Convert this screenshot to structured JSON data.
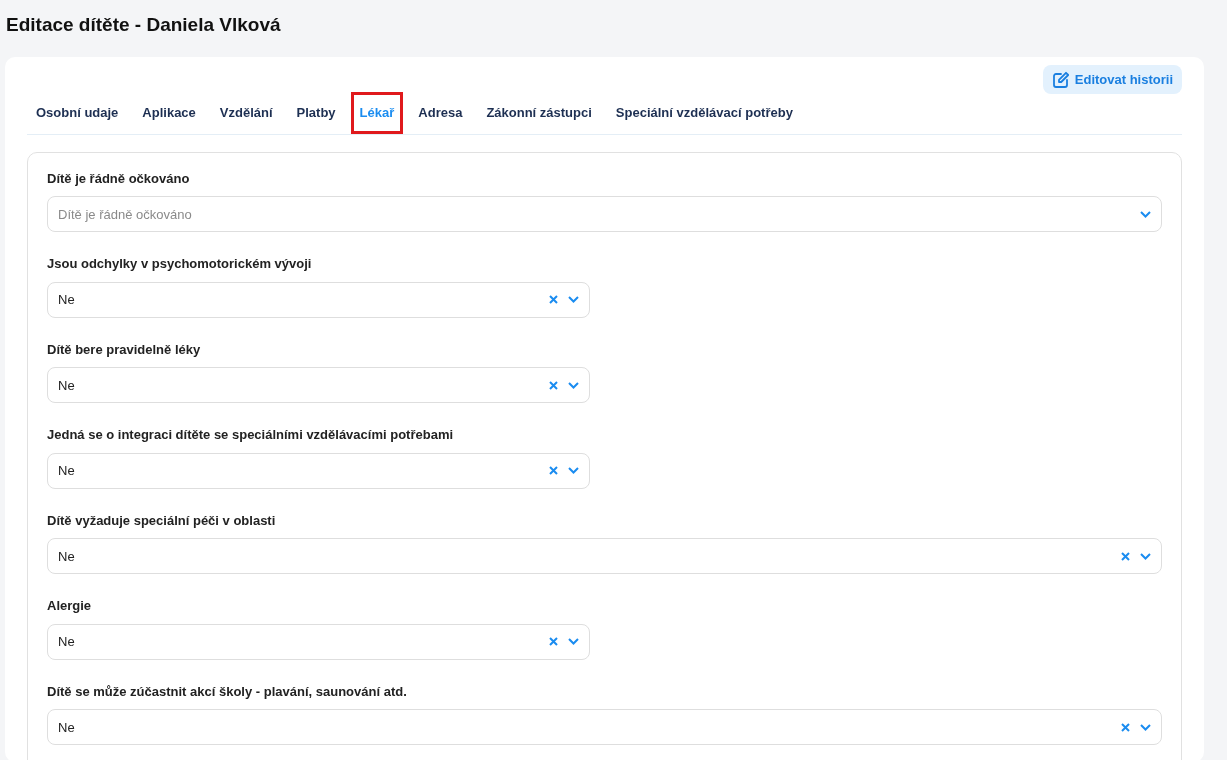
{
  "page_title": "Editace dítěte - Daniela Vlková",
  "history_button": "Editovat historii",
  "tabs": [
    {
      "label": "Osobní udaje",
      "selected": false,
      "highlighted": false
    },
    {
      "label": "Aplikace",
      "selected": false,
      "highlighted": false
    },
    {
      "label": "Vzdělání",
      "selected": false,
      "highlighted": false
    },
    {
      "label": "Platby",
      "selected": false,
      "highlighted": false
    },
    {
      "label": "Lékař",
      "selected": true,
      "highlighted": true
    },
    {
      "label": "Adresa",
      "selected": false,
      "highlighted": false
    },
    {
      "label": "Zákonní zástupci",
      "selected": false,
      "highlighted": false
    },
    {
      "label": "Speciální vzdělávací potřeby",
      "selected": false,
      "highlighted": false
    }
  ],
  "fields": [
    {
      "label": "Dítě je řádně očkováno",
      "placeholder": "Dítě je řádně očkováno",
      "kind": "wide"
    },
    {
      "label": "Jsou odchylky v psychomotorickém vývoji",
      "value": "Ne",
      "kind": "narrow"
    },
    {
      "label": "Dítě bere pravidelně léky",
      "value": "Ne",
      "kind": "narrow"
    },
    {
      "label": "Jedná se o integraci dítěte se speciálními vzdělávacími potřebami",
      "value": "Ne",
      "kind": "narrow"
    },
    {
      "label": "Dítě vyžaduje speciální péči v oblasti",
      "value": "Ne",
      "kind": "wide"
    },
    {
      "label": "Alergie",
      "value": "Ne",
      "kind": "narrow"
    },
    {
      "label": "Dítě se může zúčastnit akcí školy - plavání, saunování atd.",
      "value": "Ne",
      "kind": "wide"
    }
  ]
}
